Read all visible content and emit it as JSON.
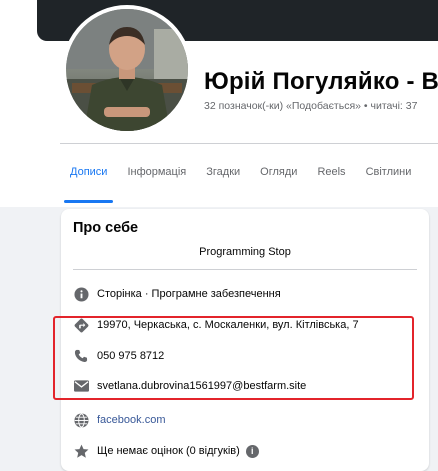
{
  "profile": {
    "name": "Юрій Погуляйко - В",
    "stats": "32 позначок(-ки) «Подобається» • читачі: 37"
  },
  "tabs": [
    {
      "label": "Дописи",
      "active": true
    },
    {
      "label": "Інформація"
    },
    {
      "label": "Згадки"
    },
    {
      "label": "Огляди"
    },
    {
      "label": "Reels"
    },
    {
      "label": "Світлини"
    }
  ],
  "about": {
    "title": "Про себе",
    "bio": "Programming Stop",
    "category": "Сторінка · Програмне забезпечення",
    "address": "19970, Черкаська, с. Москаленки, вул. Кітлівська, 7",
    "phone": "050 975 8712",
    "email": "svetlana.dubrovina1561997@bestfarm.site",
    "website": "facebook.com",
    "rating": "Ще немає оцінок (0 відгуків)",
    "info_badge": "i"
  },
  "colors": {
    "accent": "#1877f2",
    "highlight": "#e3242b",
    "icon": "#65676b",
    "link": "#385898"
  }
}
